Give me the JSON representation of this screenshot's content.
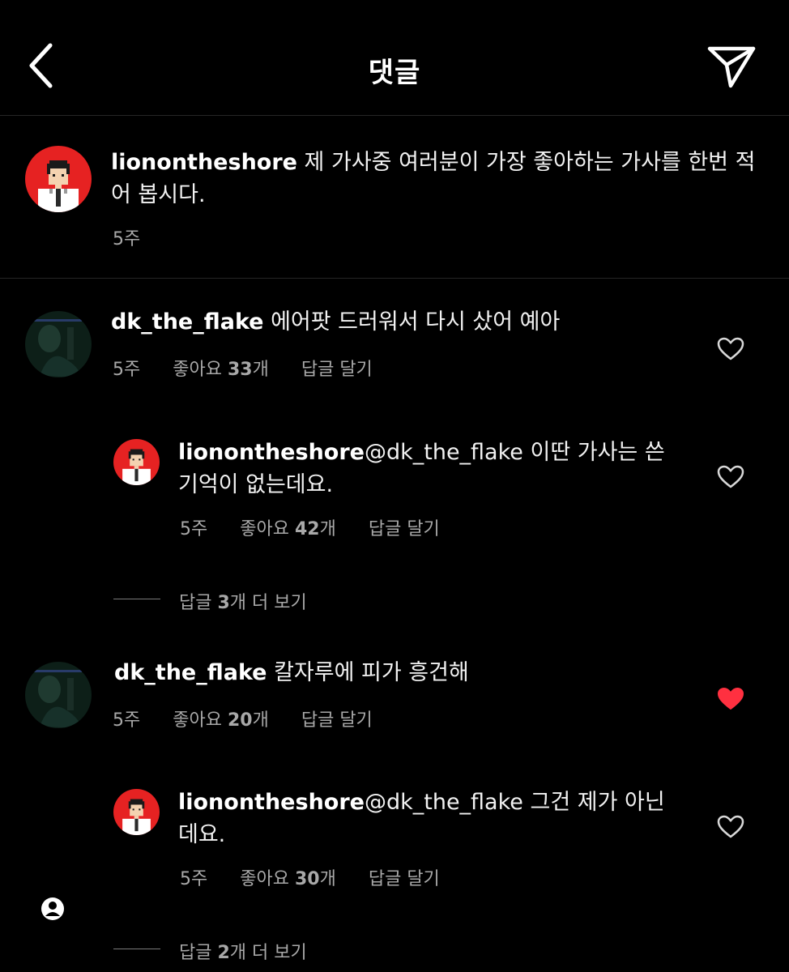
{
  "header": {
    "title": "댓글",
    "back_icon": "chevron-left-icon",
    "share_icon": "paper-plane-icon"
  },
  "caption": {
    "username": "lionontheshore",
    "text": " 제 가사중 여러분이 가장 좋아하는 가사를 한번 적어 봅시다.",
    "time": "5주"
  },
  "comments": [
    {
      "username": "dk_the_flake",
      "text": " 에어팟 드러워서 다시 샀어 예아",
      "time": "5주",
      "likes_prefix": "좋아요 ",
      "likes_count": "33",
      "likes_suffix": "개",
      "reply_label": "답글 달기",
      "liked": false,
      "reply": {
        "username": "lionontheshore",
        "text": "@dk_the_flake 이딴 가사는 쓴 기억이 없는데요.",
        "time": "5주",
        "likes_prefix": "좋아요 ",
        "likes_count": "42",
        "likes_suffix": "개",
        "reply_label": "답글 달기",
        "liked": false
      },
      "view_more": {
        "prefix": "답글 ",
        "count": "3",
        "suffix": "개 더 보기"
      }
    },
    {
      "username": "dk_the_flake",
      "text": " 칼자루에 피가 흥건해",
      "time": "5주",
      "likes_prefix": "좋아요 ",
      "likes_count": "20",
      "likes_suffix": "개",
      "reply_label": "답글 달기",
      "liked": true,
      "reply": {
        "username": "lionontheshore",
        "text": "@dk_the_flake 그건 제가 아닌데요.",
        "time": "5주",
        "likes_prefix": "좋아요 ",
        "likes_count": "30",
        "likes_suffix": "개",
        "reply_label": "답글 달기",
        "liked": false
      },
      "view_more": {
        "prefix": "답글 ",
        "count": "2",
        "suffix": "개 더 보기"
      }
    }
  ],
  "colors": {
    "background": "#000000",
    "text": "#ffffff",
    "secondary_text": "#a8a8a8",
    "liked_heart": "#ff3040",
    "avatar_red": "#e62222"
  }
}
